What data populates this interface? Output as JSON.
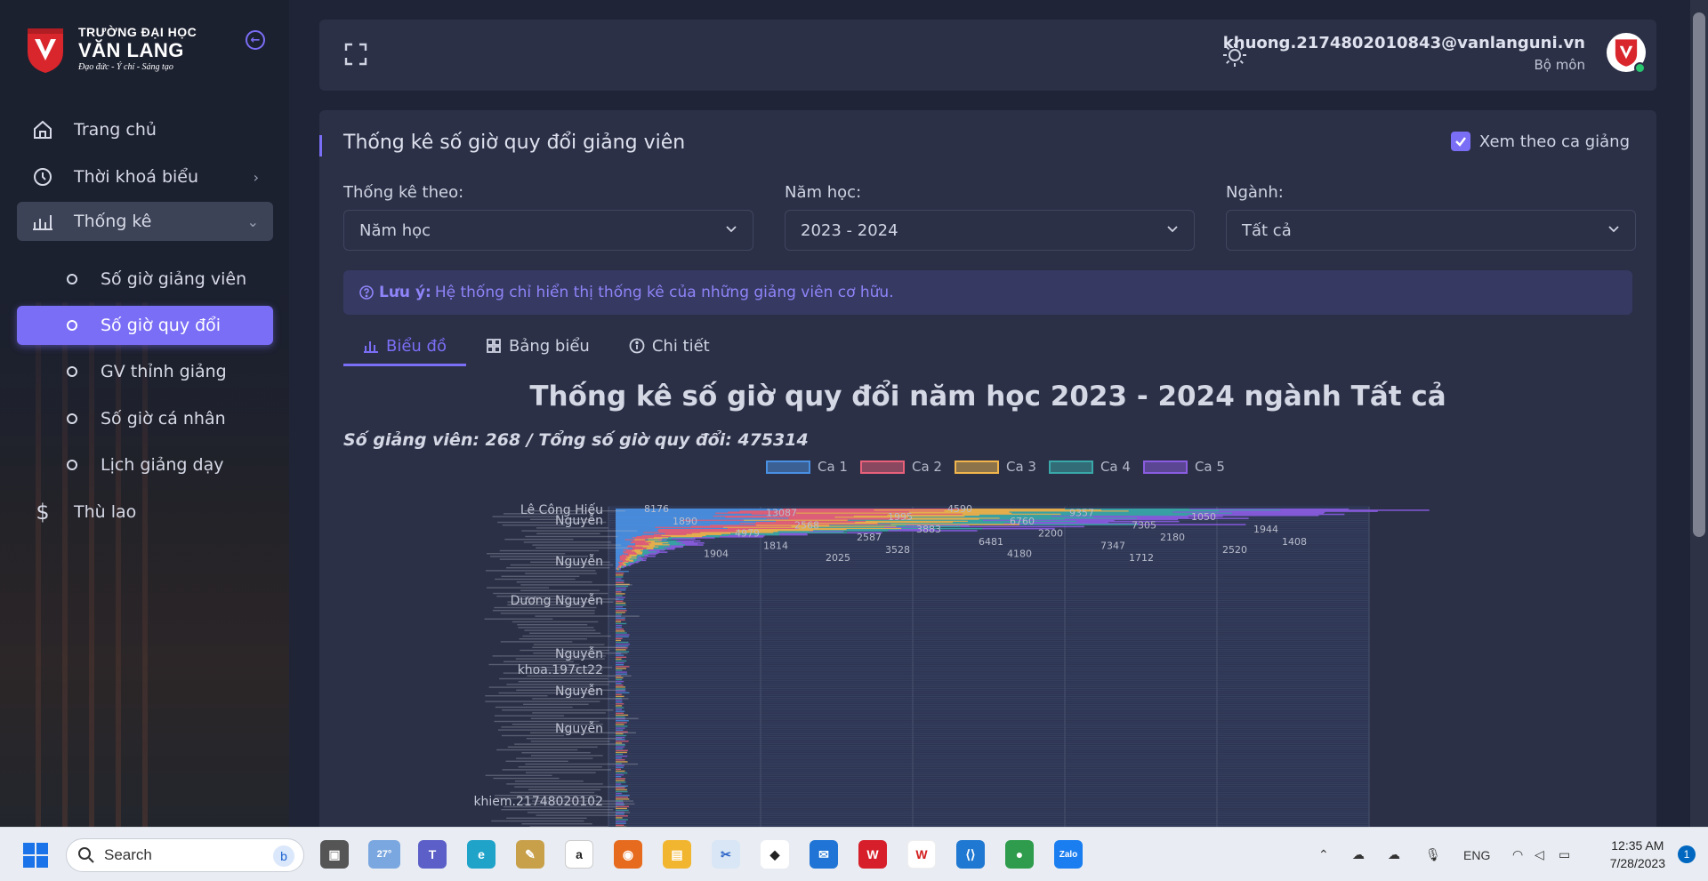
{
  "brand": {
    "line1": "TRƯỜNG ĐẠI HỌC",
    "line2": "VĂN LANG",
    "line3": "Đạo đức - Ý chí - Sáng tạo"
  },
  "sidebar": {
    "items": [
      {
        "label": "Trang chủ",
        "icon": "home-icon"
      },
      {
        "label": "Thời khoá biểu",
        "icon": "clock-icon"
      },
      {
        "label": "Thống kê",
        "icon": "bar-chart-icon"
      },
      {
        "label": "Số giờ giảng viên"
      },
      {
        "label": "Số giờ quy đổi"
      },
      {
        "label": "GV thỉnh giảng"
      },
      {
        "label": "Số giờ cá nhân"
      },
      {
        "label": "Lịch giảng dạy"
      },
      {
        "label": "Thù lao",
        "icon": "dollar-icon"
      }
    ]
  },
  "user": {
    "email": "khuong.2174802010843@vanlanguni.vn",
    "role": "Bộ môn"
  },
  "card": {
    "title": "Thống kê số giờ quy đổi giảng viên",
    "checkbox_label": "Xem theo ca giảng",
    "filters": [
      {
        "label": "Thống kê theo:",
        "value": "Năm học"
      },
      {
        "label": "Năm học:",
        "value": "2023 - 2024"
      },
      {
        "label": "Ngành:",
        "value": "Tất cả"
      }
    ],
    "notice_prefix": "Lưu ý:",
    "notice_text": "Hệ thống chỉ hiển thị thống kê của những giảng viên cơ hữu.",
    "tabs": [
      "Biểu đồ",
      "Bảng biểu",
      "Chi tiết"
    ]
  },
  "chart_data": {
    "type": "bar",
    "orientation": "horizontal-stacked",
    "title": "Thống kê số giờ quy đổi năm học 2023 - 2024 ngành Tất cả",
    "subtitle": "Số giảng viên: 268 / Tổng số giờ quy đổi: 475314",
    "legend_position": "top",
    "series": [
      {
        "name": "Ca 1",
        "color": "#4a90e2"
      },
      {
        "name": "Ca 2",
        "color": "#e8607a"
      },
      {
        "name": "Ca 3",
        "color": "#f0b54c"
      },
      {
        "name": "Ca 4",
        "color": "#3aa7a8"
      },
      {
        "name": "Ca 5",
        "color": "#8a5ce0"
      }
    ],
    "visible_category_labels": [
      "Lê Công Hiếu",
      "Nguyễn",
      "Nguyễn",
      "Dương Nguyễn",
      "Nguyễn",
      "khoa.197ct22",
      "Nguyễn",
      "Nguyễn",
      "khiem.21748020102"
    ],
    "visible_value_labels": [
      8176,
      13087,
      1995,
      6760,
      7305,
      1944,
      4979,
      2587,
      6481,
      7347,
      2520,
      1904,
      2025,
      4590,
      9357,
      1050,
      1890,
      2568,
      3883,
      2200,
      2180,
      1408,
      1814,
      3528,
      4180,
      1712
    ],
    "grid": true
  },
  "taskbar": {
    "search_placeholder": "Search",
    "weather": "27°",
    "lang": "ENG",
    "time": "12:35 AM",
    "date": "7/28/2023",
    "notifications": "1"
  }
}
